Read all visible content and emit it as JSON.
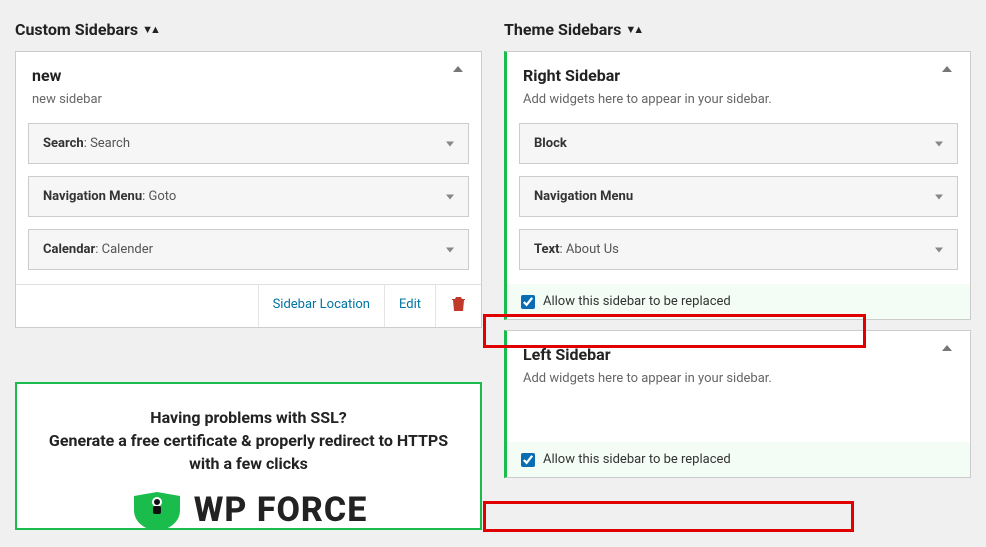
{
  "custom": {
    "title": "Custom Sidebars",
    "panel": {
      "title": "new",
      "desc": "new sidebar",
      "widgets": [
        {
          "name": "Search",
          "value": "Search"
        },
        {
          "name": "Navigation Menu",
          "value": "Goto"
        },
        {
          "name": "Calendar",
          "value": "Calender"
        }
      ],
      "actions": {
        "location": "Sidebar Location",
        "edit": "Edit"
      }
    },
    "promo": {
      "line1": "Having problems with SSL?",
      "line2": "Generate a free certificate & properly redirect to HTTPS with a few clicks",
      "logo_text": "WP FORCE"
    }
  },
  "theme": {
    "title": "Theme Sidebars",
    "right": {
      "title": "Right Sidebar",
      "desc": "Add widgets here to appear in your sidebar.",
      "widgets": [
        {
          "name": "Block",
          "value": ""
        },
        {
          "name": "Navigation Menu",
          "value": ""
        },
        {
          "name": "Text",
          "value": "About Us"
        }
      ],
      "allow_label": "Allow this sidebar to be replaced"
    },
    "left": {
      "title": "Left Sidebar",
      "desc": "Add widgets here to appear in your sidebar.",
      "allow_label": "Allow this sidebar to be replaced"
    }
  }
}
